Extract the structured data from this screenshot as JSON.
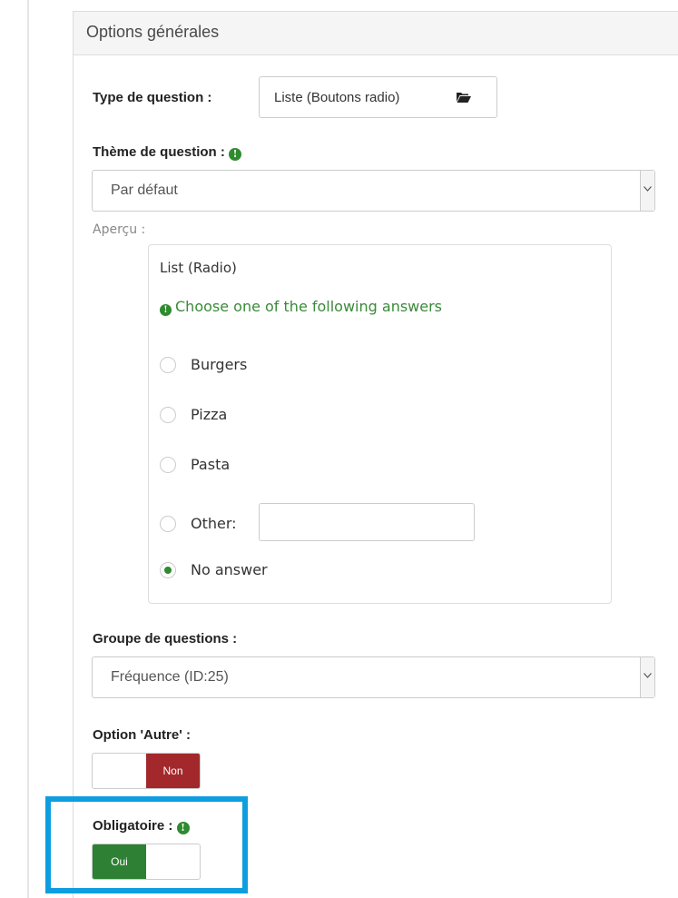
{
  "panel": {
    "heading": "Options générales"
  },
  "question_type": {
    "label": "Type de question :",
    "value": "Liste (Boutons radio)",
    "icon": "folder-open-icon"
  },
  "question_theme": {
    "label": "Thème de question :",
    "info_icon": "info-circle-icon",
    "selected": "Par défaut"
  },
  "preview": {
    "label": "Aperçu :",
    "title": "List (Radio)",
    "help": "Choose one of the following answers",
    "options": [
      {
        "label": "Burgers",
        "checked": false
      },
      {
        "label": "Pizza",
        "checked": false
      },
      {
        "label": "Pasta",
        "checked": false
      },
      {
        "label": "Other:",
        "checked": false
      },
      {
        "label": "No answer",
        "checked": true
      }
    ],
    "other_value": ""
  },
  "question_group": {
    "label": "Groupe de questions :",
    "selected": "Fréquence (ID:25)"
  },
  "other_option": {
    "label": "Option 'Autre' :",
    "state_label": "Non"
  },
  "mandatory": {
    "label": "Obligatoire :",
    "state_label": "Oui"
  },
  "colors": {
    "accent_green": "#2e8b2e",
    "toggle_no": "#a3282b",
    "toggle_yes": "#2e8134",
    "highlight": "#0e9ee0"
  }
}
